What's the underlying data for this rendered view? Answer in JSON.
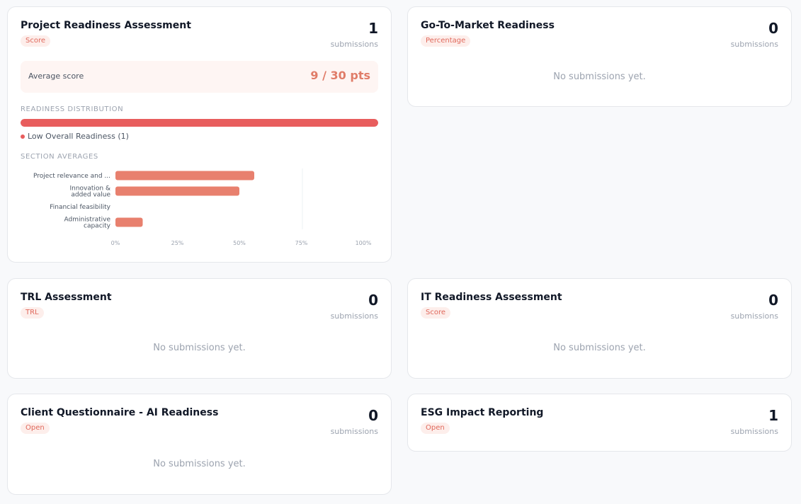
{
  "cards": {
    "project_readiness": {
      "title": "Project Readiness Assessment",
      "badge": "Score",
      "count": "1",
      "count_label": "submissions",
      "average": {
        "label": "Average score",
        "value": "9 / 30 pts"
      },
      "distribution": {
        "section_label": "READINESS DISTRIBUTION",
        "legend": "Low Overall Readiness (1)",
        "fill_percent": 100
      },
      "section_averages": {
        "section_label": "SECTION AVERAGES"
      }
    },
    "go_to_market": {
      "title": "Go-To-Market Readiness",
      "badge": "Percentage",
      "count": "0",
      "count_label": "submissions",
      "empty": "No submissions yet."
    },
    "trl": {
      "title": "TRL Assessment",
      "badge": "TRL",
      "count": "0",
      "count_label": "submissions",
      "empty": "No submissions yet."
    },
    "it_readiness": {
      "title": "IT Readiness Assessment",
      "badge": "Score",
      "count": "0",
      "count_label": "submissions",
      "empty": "No submissions yet."
    },
    "client_questionnaire": {
      "title": "Client Questionnaire - AI Readiness",
      "badge": "Open",
      "count": "0",
      "count_label": "submissions",
      "empty": "No submissions yet."
    },
    "esg": {
      "title": "ESG Impact Reporting",
      "badge": "Open",
      "count": "1",
      "count_label": "submissions"
    }
  },
  "colors": {
    "accent": "#e85d5d",
    "bar": "#e8806e",
    "badge_bg": "#fdeeeb",
    "badge_text": "#e0685b"
  },
  "chart_data": {
    "type": "bar",
    "orientation": "horizontal",
    "categories": [
      [
        "Project relevance and ..."
      ],
      [
        "Innovation &",
        "added value"
      ],
      [
        "Financial feasibility"
      ],
      [
        "Administrative",
        "capacity"
      ]
    ],
    "values": [
      56,
      50,
      0,
      11
    ],
    "xlim": [
      0,
      100
    ],
    "ticks": [
      "0%",
      "25%",
      "50%",
      "75%",
      "100%"
    ],
    "tick_values": [
      0,
      25,
      50,
      75,
      100
    ]
  }
}
